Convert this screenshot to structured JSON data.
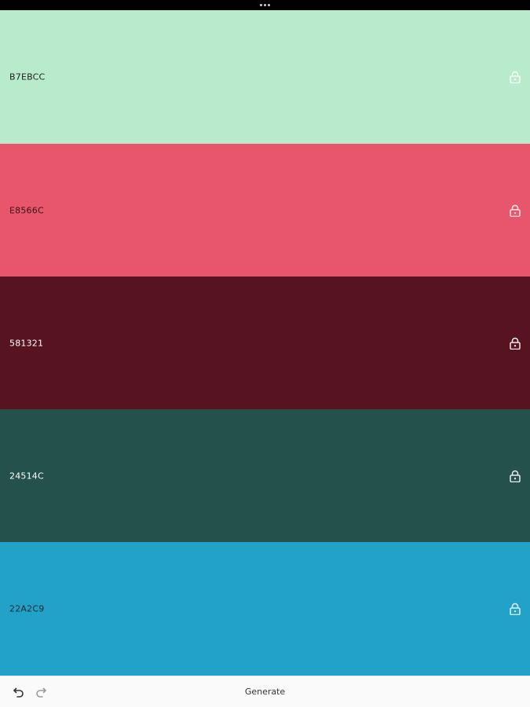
{
  "app": {
    "toolbar": {
      "generate_label": "Generate",
      "undo_icon": "undo-icon",
      "redo_icon": "redo-icon"
    },
    "colors": [
      {
        "hex": "B7EBCC",
        "bg": "#B7EBCC",
        "text_color": "#222222",
        "lock_color": "#ffffff",
        "lock_opacity": 0.85,
        "locked": false
      },
      {
        "hex": "E8566C",
        "bg": "#E8566C",
        "text_color": "#3a1016",
        "lock_color": "#ffffff",
        "lock_opacity": 0.85,
        "locked": false
      },
      {
        "hex": "581321",
        "bg": "#581321",
        "text_color": "#ffffff",
        "lock_color": "#ffffff",
        "lock_opacity": 0.9,
        "locked": false
      },
      {
        "hex": "24514C",
        "bg": "#24514C",
        "text_color": "#ffffff",
        "lock_color": "#ffffff",
        "lock_opacity": 0.9,
        "locked": false
      },
      {
        "hex": "22A2C9",
        "bg": "#22A2C9",
        "text_color": "#1a2a2f",
        "lock_color": "#ffffff",
        "lock_opacity": 0.85,
        "locked": false
      }
    ]
  }
}
